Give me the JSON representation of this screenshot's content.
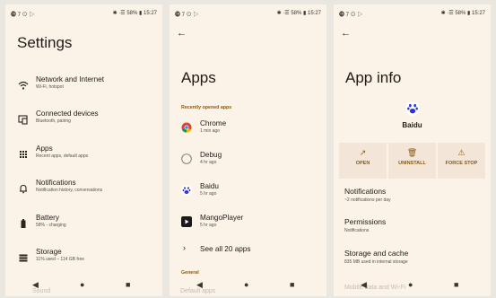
{
  "status": {
    "left": "⓳ 7 ⊙ ▷",
    "right": "✱ ·☰ 58% ▮ 15:27"
  },
  "settings": {
    "title": "Settings",
    "items": [
      {
        "label": "Network and Internet",
        "sub": "Wi-Fi, hotspot",
        "icon": "wifi-icon"
      },
      {
        "label": "Connected devices",
        "sub": "Bluetooth, pairing",
        "icon": "devices-icon"
      },
      {
        "label": "Apps",
        "sub": "Recent apps, default apps",
        "icon": "apps-grid-icon"
      },
      {
        "label": "Notifications",
        "sub": "Notification history, conversations",
        "icon": "bell-icon"
      },
      {
        "label": "Battery",
        "sub": "58% - charging",
        "icon": "battery-icon"
      },
      {
        "label": "Storage",
        "sub": "11% used – 114 GB free",
        "icon": "storage-icon"
      }
    ],
    "ghost": "Sound"
  },
  "apps": {
    "title": "Apps",
    "recent_label": "Recently opened apps",
    "list": [
      {
        "name": "Chrome",
        "time": "1 min ago"
      },
      {
        "name": "Debug",
        "time": "4 hr ago"
      },
      {
        "name": "Baidu",
        "time": "5 hr ago"
      },
      {
        "name": "MangoPlayer",
        "time": "5 hr ago"
      }
    ],
    "see_all": "See all 20 apps",
    "general_label": "General",
    "ghost": "Default apps"
  },
  "appinfo": {
    "title": "App info",
    "app_name": "Baidu",
    "actions": [
      {
        "label": "OPEN"
      },
      {
        "label": "UNINSTALL"
      },
      {
        "label": "FORCE STOP"
      }
    ],
    "rows": [
      {
        "title": "Notifications",
        "sub": "~2 notifications per day"
      },
      {
        "title": "Permissions",
        "sub": "Notifications"
      },
      {
        "title": "Storage and cache",
        "sub": "835 MB used in internal storage"
      }
    ],
    "ghost": "Mobile data and Wi-Fi"
  },
  "colors": {
    "accent": "#8a5a12",
    "background": "#fbf2e8"
  }
}
